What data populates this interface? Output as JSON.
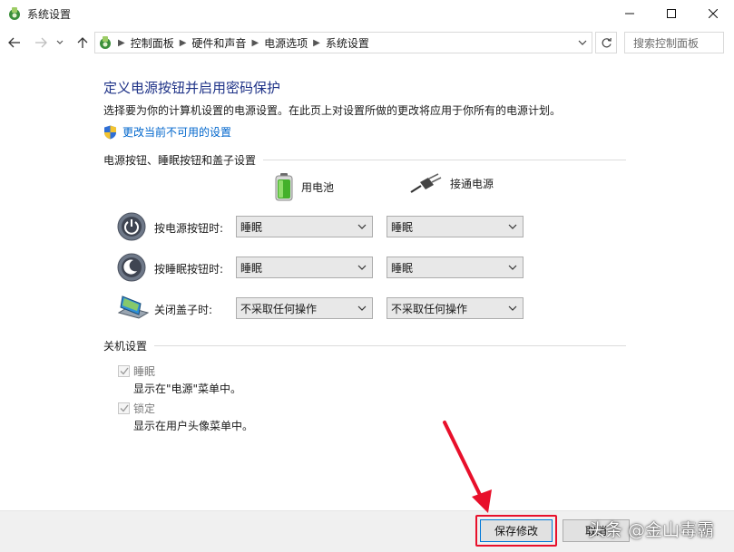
{
  "window": {
    "title": "系统设置"
  },
  "address": {
    "breadcrumbs": [
      "控制面板",
      "硬件和声音",
      "电源选项",
      "系统设置"
    ],
    "search_placeholder": "搜索控制面板"
  },
  "content": {
    "title": "定义电源按钮并启用密码保护",
    "description": "选择要为你的计算机设置的电源设置。在此页上对设置所做的更改将应用于你所有的电源计划。",
    "change_link": "更改当前不可用的设置",
    "power_group_label": "电源按钮、睡眠按钮和盖子设置",
    "column_battery": "用电池",
    "column_plugged": "接通电源",
    "rows": [
      {
        "label": "按电源按钮时:",
        "battery": "睡眠",
        "plugged": "睡眠"
      },
      {
        "label": "按睡眠按钮时:",
        "battery": "睡眠",
        "plugged": "睡眠"
      },
      {
        "label": "关闭盖子时:",
        "battery": "不采取任何操作",
        "plugged": "不采取任何操作"
      }
    ],
    "shutdown_group_label": "关机设置",
    "shutdown_options": [
      {
        "label": "睡眠",
        "description": "显示在\"电源\"菜单中。",
        "checked": true
      },
      {
        "label": "锁定",
        "description": "显示在用户头像菜单中。",
        "checked": true
      }
    ]
  },
  "footer": {
    "save_label": "保存修改",
    "cancel_label": "取消"
  },
  "watermark": "头条 @金山毒霸",
  "colors": {
    "title_blue": "#1e3287",
    "link_blue": "#0066cc",
    "focus_blue": "#0078d7",
    "highlight_red": "#e8102b"
  }
}
